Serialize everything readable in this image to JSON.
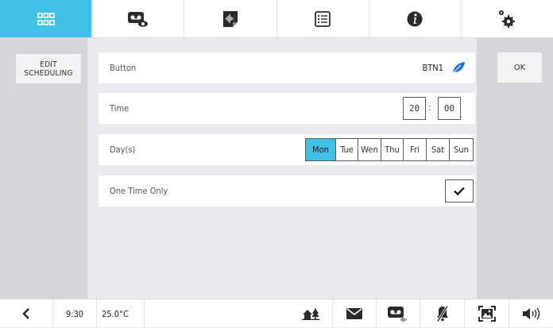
{
  "top_tabs": [
    {
      "icon": "apps-grid-icon",
      "active": true
    },
    {
      "icon": "voicemail-view-icon",
      "active": false
    },
    {
      "icon": "audio-note-icon",
      "active": false
    },
    {
      "icon": "list-icon",
      "active": false
    },
    {
      "icon": "info-icon",
      "active": false
    },
    {
      "icon": "settings-gears-icon",
      "active": false
    }
  ],
  "sidebar": {
    "edit_scheduling_line1": "EDIT",
    "edit_scheduling_line2": "SCHEDULING"
  },
  "actions": {
    "ok_label": "OK"
  },
  "form": {
    "button_label": "Button",
    "button_value": "BTN1",
    "time_label": "Time",
    "time_hours": "20",
    "time_separator": ":",
    "time_minutes": "00",
    "days_label": "Day(s)",
    "days": [
      {
        "label": "Mon",
        "selected": true
      },
      {
        "label": "Tue",
        "selected": false
      },
      {
        "label": "Wen",
        "selected": false
      },
      {
        "label": "Thu",
        "selected": false
      },
      {
        "label": "Fri",
        "selected": false
      },
      {
        "label": "Sat",
        "selected": false
      },
      {
        "label": "Sun",
        "selected": false
      }
    ],
    "one_time_label": "One Time Only",
    "one_time_checked": true
  },
  "status_bar": {
    "time": "9:30",
    "temperature": "25.0°C",
    "icons": [
      "back-chevron-icon",
      "home-tree-icon",
      "mail-icon",
      "voicemail-icon",
      "muted-bell-icon",
      "photo-frame-icon",
      "speaker-volume-icon"
    ]
  },
  "colors": {
    "accent": "#3fc0e6",
    "leaf": "#1f6fe0",
    "panel": "#d4d6da",
    "background": "#e9ebef"
  }
}
